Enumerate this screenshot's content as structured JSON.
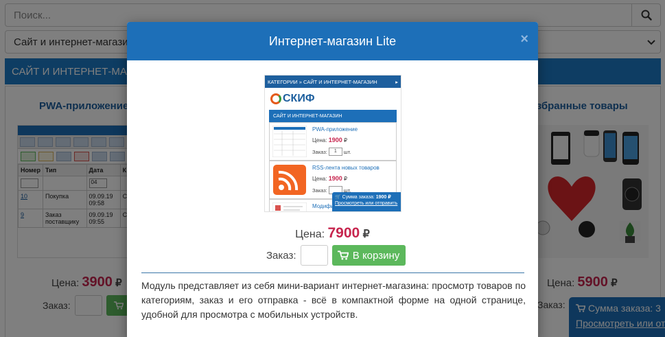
{
  "search": {
    "placeholder": "Поиск..."
  },
  "category_select": {
    "selected": "Сайт и интернет-магазин"
  },
  "category_bar": {
    "title": "САЙТ И ИНТЕРНЕТ-МАГАЗИН"
  },
  "cards": {
    "left": {
      "title": "PWA-приложение",
      "price_label": "Цена:",
      "price": "3900",
      "currency": "₽",
      "order_label": "Заказ:",
      "table": {
        "headers": [
          "Номер",
          "Тип",
          "Дата",
          "К"
        ],
        "date_filter": "04",
        "rows": [
          {
            "num": "10",
            "type": "Покупка",
            "date": "09.09.19 09:58",
            "extra": "Сп"
          },
          {
            "num": "9",
            "type": "Заказ поставщику",
            "date": "09.09.19 09:55",
            "extra": "Сп"
          }
        ]
      }
    },
    "right": {
      "title": "Избранные товары",
      "price_label": "Цена:",
      "price": "5900",
      "currency": "₽",
      "order_label": "Заказ:"
    }
  },
  "floating_cart": {
    "label": "Сумма заказа: 3",
    "link": "Просмотреть или от"
  },
  "modal": {
    "title": "Интернет-магазин Lite",
    "close_symbol": "×",
    "preview": {
      "breadcrumb": "КАТЕГОРИИ » САЙТ И ИНТЕРНЕТ-МАГАЗИН",
      "logo_text": "СКИФ",
      "category_title": "САЙТ И ИНТЕРНЕТ-МАГАЗИН",
      "items": [
        {
          "name": "PWA-приложение",
          "price_label": "Цена:",
          "price": "1900",
          "currency": "₽",
          "order_label": "Заказ:",
          "qty": "1",
          "unit": "шт."
        },
        {
          "name": "RSS-лента новых товаров",
          "price_label": "Цена:",
          "price": "1900",
          "currency": "₽",
          "order_label": "Заказ:",
          "qty": "",
          "unit": "шт."
        },
        {
          "name": "Модифи"
        }
      ],
      "float_cart_label": "Сумма заказа:",
      "float_cart_value": "1900 ₽",
      "float_cart_link": "Просмотреть или отправить"
    },
    "price_label": "Цена:",
    "price": "7900",
    "currency": "₽",
    "order_label": "Заказ:",
    "cart_button": "В корзину",
    "description": "Модуль представляет из себя мини-вариант интернет-магазина: просмотр товаров по категориям, заказ и его отправка - всё в компактной форме на одной странице, удобной для просмотра с мобильных устройств."
  },
  "colors": {
    "primary": "#1d6fb8",
    "price": "#c7254e",
    "cart_button": "#5cb85c"
  }
}
